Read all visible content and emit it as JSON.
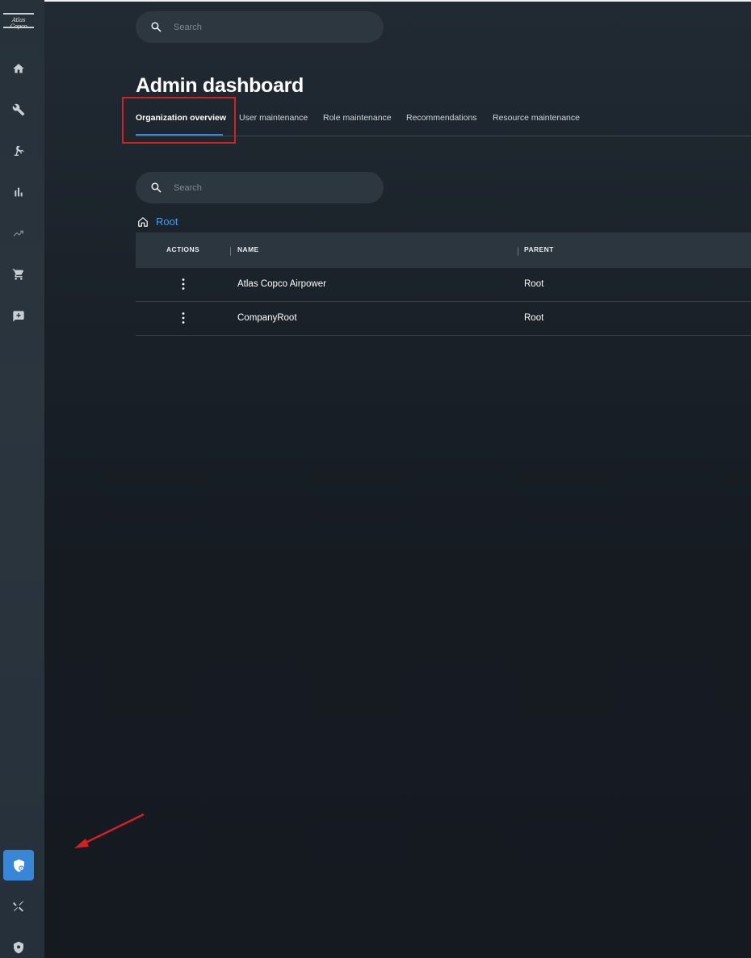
{
  "app": {
    "logo_text": "Atlas Copco"
  },
  "sidebar": {
    "items": [
      {
        "icon": "home-icon"
      },
      {
        "icon": "wrench-icon"
      },
      {
        "icon": "robot-arm-icon"
      },
      {
        "icon": "bar-chart-icon"
      },
      {
        "icon": "trend-icon"
      },
      {
        "icon": "cart-icon"
      },
      {
        "icon": "feedback-icon"
      }
    ],
    "bottom_items": [
      {
        "icon": "admin-shield-icon",
        "active": true
      },
      {
        "icon": "tools-icon"
      },
      {
        "icon": "security-shield-icon"
      }
    ]
  },
  "header": {
    "search_placeholder": "Search"
  },
  "page": {
    "title": "Admin dashboard",
    "tabs": [
      {
        "label": "Organization overview",
        "active": true
      },
      {
        "label": "User maintenance"
      },
      {
        "label": "Role maintenance"
      },
      {
        "label": "Recommendations"
      },
      {
        "label": "Resource maintenance"
      }
    ]
  },
  "org": {
    "search_placeholder": "Search",
    "breadcrumb": "Root",
    "columns": {
      "actions": "ACTIONS",
      "name": "NAME",
      "parent": "PARENT"
    },
    "rows": [
      {
        "name": "Atlas Copco Airpower",
        "parent": "Root"
      },
      {
        "name": "CompanyRoot",
        "parent": "Root"
      }
    ]
  },
  "annotation": {
    "highlight_color": "#d32020"
  },
  "colors": {
    "accent": "#3a86d6",
    "link": "#4a9ae8",
    "background": "#161c24",
    "sidebar": "#2b353e"
  }
}
